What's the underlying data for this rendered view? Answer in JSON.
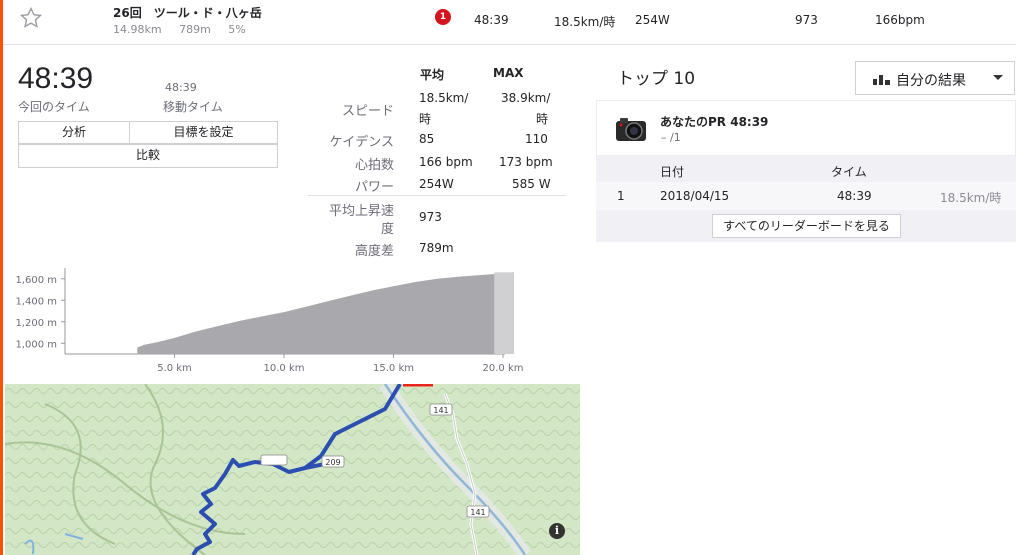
{
  "segment": {
    "title": "26回　ツール・ド・八ヶ岳",
    "distance": "14.98km",
    "elevation": "789m",
    "grade": "5%",
    "rank": "1",
    "time": "48:39",
    "speed": "18.5km/時",
    "power": "254W",
    "vam": "973",
    "heart_rate": "166bpm"
  },
  "summary": {
    "elapsed_time": "48:39",
    "elapsed_label": "今回のタイム",
    "moving_time": "48:39",
    "moving_label": "移動タイム",
    "btn_analysis": "分析",
    "btn_goal": "目標を設定",
    "btn_compare": "比較"
  },
  "stats": {
    "head_avg": "平均",
    "head_max": "MAX",
    "speed": {
      "label": "スピード",
      "avg_line1": "18.5km/",
      "avg_line2": "時",
      "max_line1": "38.9km/",
      "max_line2": "時"
    },
    "cadence": {
      "label": "ケイデンス",
      "avg": "85",
      "max": "110"
    },
    "heart_rate": {
      "label": "心拍数",
      "avg": "166 bpm",
      "max": "173 bpm"
    },
    "power": {
      "label": "パワー",
      "avg": "254W",
      "max": "585 W"
    },
    "vam": {
      "label_line1": "平均上昇速",
      "label_line2": "度",
      "value": "973"
    },
    "elevation_gain": {
      "label": "高度差",
      "value": "789m"
    }
  },
  "chart_data": {
    "type": "area",
    "title": "",
    "xlabel": "",
    "ylabel": "",
    "x_ticks": [
      "5.0 km",
      "10.0 km",
      "15.0 km",
      "20.0 km"
    ],
    "y_ticks": [
      "1,000 m",
      "1,200 m",
      "1,400 m",
      "1,600 m"
    ],
    "xlim": [
      0,
      20
    ],
    "ylim": [
      900,
      1700
    ],
    "x": [
      3.3,
      3.6,
      4.2,
      5.0,
      6.0,
      7.0,
      8.0,
      9.0,
      10.0,
      11.0,
      12.0,
      13.0,
      14.0,
      15.0,
      16.0,
      17.0,
      18.0,
      19.0,
      20.0,
      20.5
    ],
    "y": [
      960,
      985,
      1010,
      1050,
      1110,
      1160,
      1210,
      1250,
      1290,
      1340,
      1390,
      1440,
      1490,
      1530,
      1570,
      1600,
      1620,
      1635,
      1650,
      1660
    ],
    "grid": false
  },
  "map": {
    "road_labels": [
      "141",
      "209",
      "141"
    ],
    "info_icon": "i"
  },
  "leaderboard": {
    "title": "トップ 10",
    "filter_label": "自分の結果",
    "pr_title": "あなたのPR 48:39",
    "pr_sub": "– /1",
    "col_date": "日付",
    "col_time": "タイム",
    "rows": [
      {
        "rank": "1",
        "date": "2018/04/15",
        "time": "48:39",
        "speed": "18.5km/時"
      }
    ],
    "view_all": "すべてのリーダーボードを見る"
  },
  "colors": {
    "accent": "#fc5200",
    "route": "#2a4fb0",
    "pr_badge": "#d4141e"
  }
}
